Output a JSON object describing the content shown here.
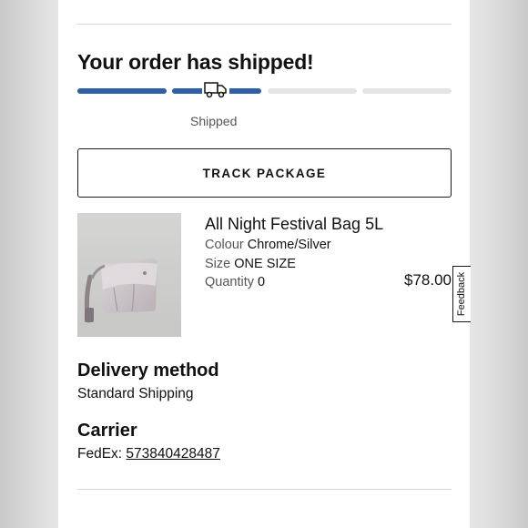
{
  "order": {
    "title": "Your order has shipped!",
    "progress_steps_total": 4,
    "progress_steps_completed": 2,
    "current_status": "Shipped",
    "track_button_label": "TRACK PACKAGE"
  },
  "item": {
    "name": "All Night Festival Bag 5L",
    "colour_label": "Colour",
    "colour_value": "Chrome/Silver",
    "size_label": "Size",
    "size_value": "ONE SIZE",
    "quantity_label": "Quantity",
    "quantity_value": "0",
    "price": "$78.00"
  },
  "delivery": {
    "heading": "Delivery method",
    "method": "Standard Shipping"
  },
  "carrier": {
    "heading": "Carrier",
    "prefix": "FedEx:",
    "tracking_number": "573840428487"
  },
  "feedback_tab": {
    "label": "Feedback"
  },
  "colors": {
    "progress_fill": "#2f5fa6",
    "progress_track": "#e5e5e5"
  },
  "icons": {
    "progress_marker": "truck-icon"
  }
}
